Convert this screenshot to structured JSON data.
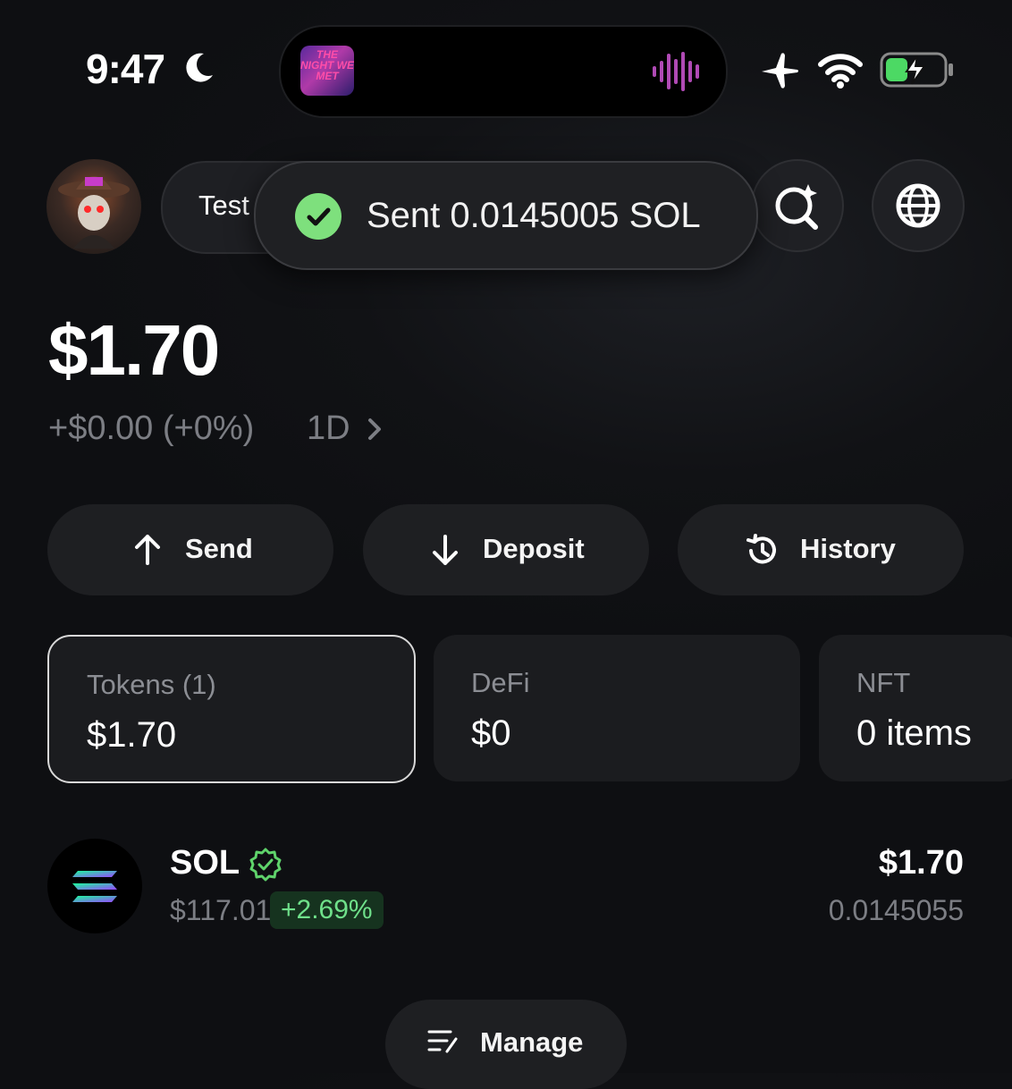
{
  "status_bar": {
    "time": "9:47",
    "now_playing_art_text": "THE NIGHT WE MET"
  },
  "header": {
    "wallet_name": "Test"
  },
  "toast": {
    "message": "Sent 0.0145005 SOL"
  },
  "balance": {
    "total": "$1.70",
    "change": "+$0.00 (+0%)",
    "period": "1D"
  },
  "actions": {
    "send": "Send",
    "deposit": "Deposit",
    "history": "History"
  },
  "cards": {
    "tokens": {
      "label": "Tokens (1)",
      "value": "$1.70"
    },
    "defi": {
      "label": "DeFi",
      "value": "$0"
    },
    "nft": {
      "label": "NFT",
      "value": "0 items"
    }
  },
  "token_list": [
    {
      "symbol": "SOL",
      "price": "$117.01",
      "change": "+2.69%",
      "value": "$1.70",
      "amount": "0.0145055"
    }
  ],
  "manage": {
    "label": "Manage"
  },
  "colors": {
    "background": "#111215",
    "success": "#7ee07d",
    "positive_change": "#6fe08a",
    "muted_text": "#7c7e84"
  }
}
